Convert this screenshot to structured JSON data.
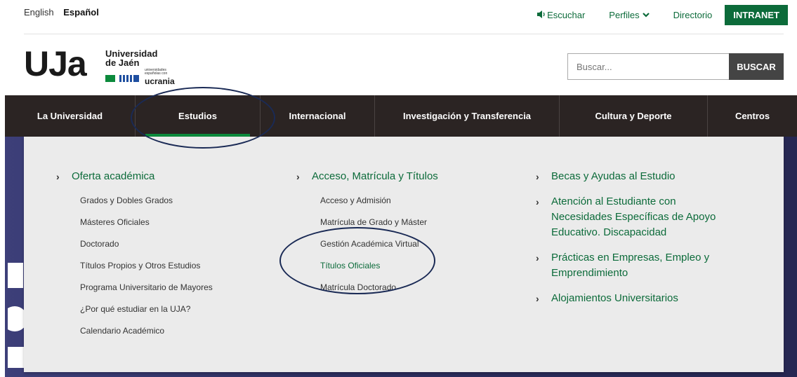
{
  "languages": [
    {
      "label": "English",
      "active": false
    },
    {
      "label": "Español",
      "active": true
    }
  ],
  "top_links": {
    "listen": "Escuchar",
    "profiles": "Perfiles",
    "directory": "Directorio",
    "intranet": "INTRANET"
  },
  "logo": {
    "mark": "UJa",
    "university_line1": "Universidad",
    "university_line2": "de Jaén",
    "small_text": "universidades españolas con",
    "ukraine": "ucrania"
  },
  "search": {
    "placeholder": "Buscar...",
    "button": "BUSCAR"
  },
  "nav": [
    {
      "label": "La Universidad"
    },
    {
      "label": "Estudios",
      "active": true
    },
    {
      "label": "Internacional"
    },
    {
      "label": "Investigación y Transferencia"
    },
    {
      "label": "Cultura y Deporte"
    },
    {
      "label": "Centros"
    }
  ],
  "menu": {
    "col1": {
      "heading": "Oferta académica",
      "items": [
        "Grados y Dobles Grados",
        "Másteres Oficiales",
        "Doctorado",
        "Títulos Propios y Otros Estudios",
        "Programa Universitario de Mayores",
        "¿Por qué estudiar en la UJA?",
        "Calendario Académico"
      ]
    },
    "col2": {
      "heading": "Acceso, Matrícula y Títulos",
      "items": [
        "Acceso y Admisión",
        "Matrícula de Grado y Máster",
        "Gestión Académica Virtual",
        "Títulos Oficiales",
        "Matrícula Doctorado"
      ]
    },
    "col3": {
      "items": [
        "Becas y Ayudas al Estudio",
        "Atención al Estudiante con Necesidades Específicas de Apoyo Educativo. Discapacidad",
        "Prácticas en Empresas, Empleo y Emprendimiento",
        "Alojamientos Universitarios"
      ]
    }
  },
  "colors": {
    "brand_green": "#0c6b3a",
    "nav_bg": "#2b2423",
    "annotation": "#1a2a55"
  }
}
